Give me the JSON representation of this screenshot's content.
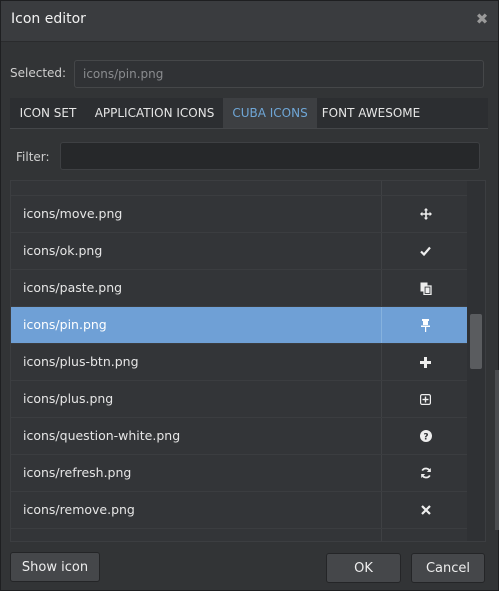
{
  "dialog": {
    "title": "Icon editor",
    "close_glyph": "✖"
  },
  "selected": {
    "label": "Selected:",
    "value": "icons/pin.png"
  },
  "tabs": [
    {
      "label": "ICON SET",
      "active": false
    },
    {
      "label": "APPLICATION ICONS",
      "active": false
    },
    {
      "label": "CUBA ICONS",
      "active": true
    },
    {
      "label": "FONT AWESOME",
      "active": false
    }
  ],
  "filter": {
    "label": "Filter:",
    "value": ""
  },
  "table": {
    "rows": [
      {
        "name": "icons/move.png",
        "icon": "move-icon",
        "glyph": "✥"
      },
      {
        "name": "icons/ok.png",
        "icon": "check-icon",
        "glyph": "✔"
      },
      {
        "name": "icons/paste.png",
        "icon": "paste-icon",
        "glyph": ""
      },
      {
        "name": "icons/pin.png",
        "icon": "pin-icon",
        "glyph": "",
        "selected": true
      },
      {
        "name": "icons/plus-btn.png",
        "icon": "plus-icon",
        "glyph": "✚"
      },
      {
        "name": "icons/plus.png",
        "icon": "plus-square-icon",
        "glyph": "⊞"
      },
      {
        "name": "icons/question-white.png",
        "icon": "question-circle-icon",
        "glyph": "?"
      },
      {
        "name": "icons/refresh.png",
        "icon": "refresh-icon",
        "glyph": ""
      },
      {
        "name": "icons/remove.png",
        "icon": "remove-icon",
        "glyph": "✖"
      }
    ]
  },
  "buttons": {
    "show_icon": "Show icon",
    "ok": "OK",
    "cancel": "Cancel"
  },
  "colors": {
    "accent": "#6fa6d6",
    "selected_row": "#6fa0d6",
    "background": "#323436"
  }
}
